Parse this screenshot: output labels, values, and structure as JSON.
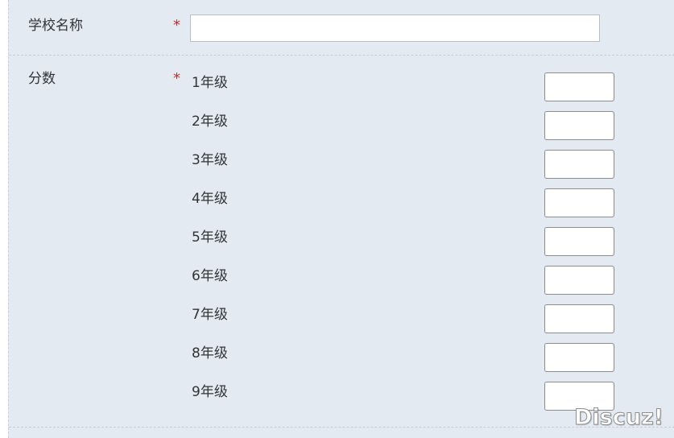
{
  "form": {
    "school": {
      "label": "学校名称",
      "required_mark": "*",
      "value": "",
      "placeholder": ""
    },
    "score": {
      "label": "分数",
      "required_mark": "*",
      "grades": [
        {
          "label": "1年级",
          "value": ""
        },
        {
          "label": "2年级",
          "value": ""
        },
        {
          "label": "3年级",
          "value": ""
        },
        {
          "label": "4年级",
          "value": ""
        },
        {
          "label": "5年级",
          "value": ""
        },
        {
          "label": "6年级",
          "value": ""
        },
        {
          "label": "7年级",
          "value": ""
        },
        {
          "label": "8年级",
          "value": ""
        },
        {
          "label": "9年级",
          "value": ""
        }
      ]
    }
  },
  "watermark": {
    "text": "Discuz!"
  },
  "colors": {
    "panel_background": "#e4eaf1",
    "required": "#e02020",
    "label_text": "#333333"
  }
}
